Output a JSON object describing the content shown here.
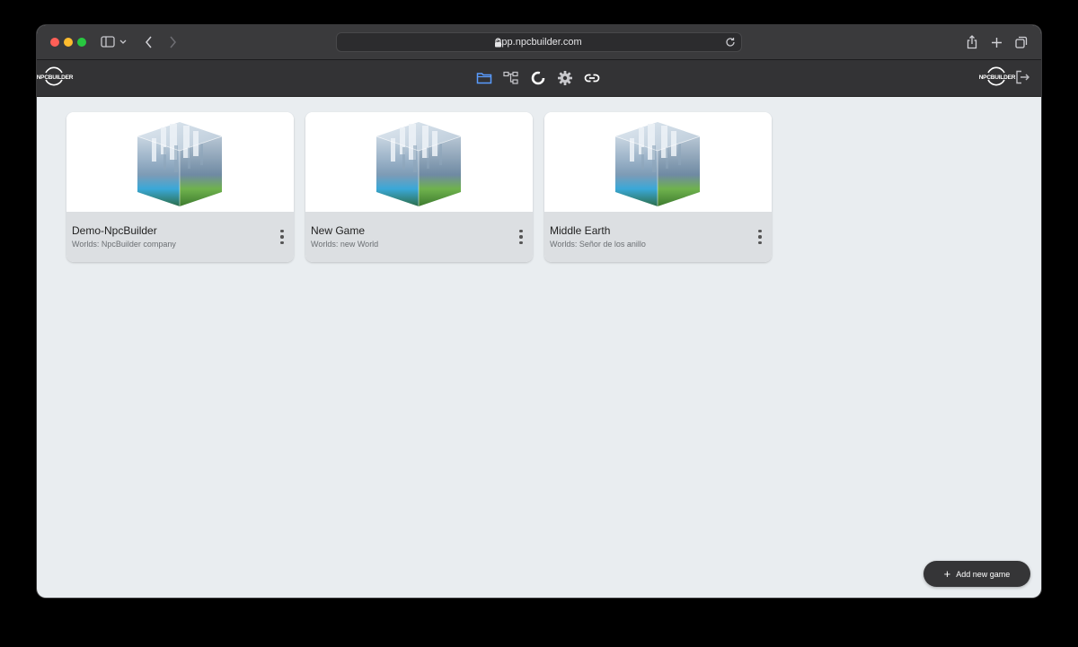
{
  "browser": {
    "url": "app.npcbuilder.com"
  },
  "app": {
    "logo_text": "NPCBUILDER",
    "accent_color": "#5a9cff",
    "nav": [
      {
        "icon": "folder-icon",
        "active": true
      },
      {
        "icon": "tree-icon",
        "active": false
      },
      {
        "icon": "donut-icon",
        "active": false
      },
      {
        "icon": "gear-icon",
        "active": false
      },
      {
        "icon": "link-icon",
        "active": false
      }
    ]
  },
  "games": [
    {
      "title": "Demo-NpcBuilder",
      "worlds": "Worlds: NpcBuilder company"
    },
    {
      "title": "New Game",
      "worlds": "Worlds: new World"
    },
    {
      "title": "Middle Earth",
      "worlds": "Worlds: Señor de los anillo"
    }
  ],
  "actions": {
    "add_new_game": "Add new game",
    "add_icon": "+"
  }
}
